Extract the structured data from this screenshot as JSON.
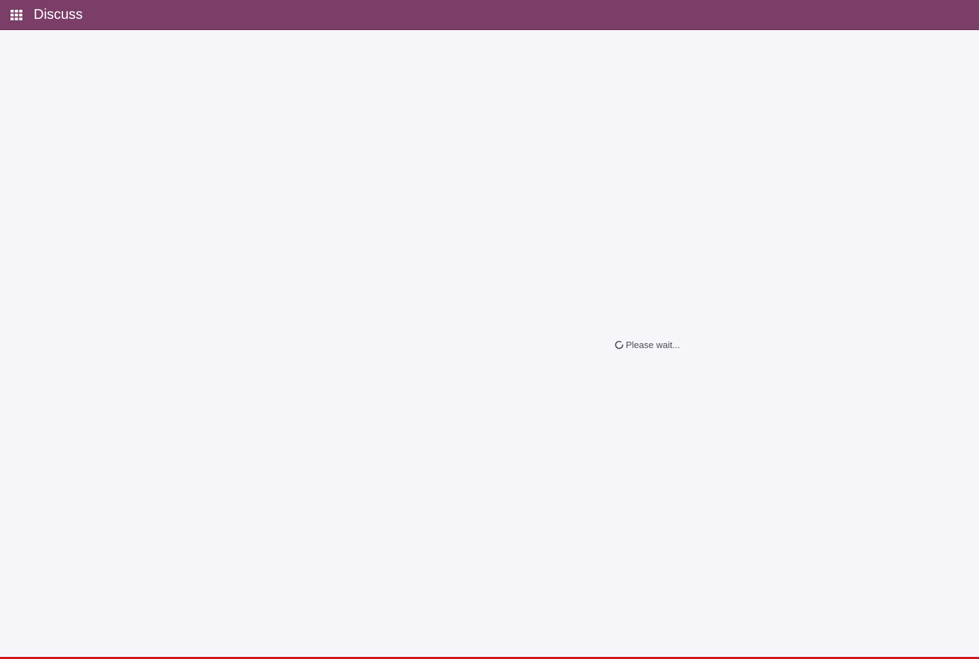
{
  "navbar": {
    "app_title": "Discuss",
    "apps_icon": "apps-grid-icon",
    "background_color": "#7a3e68"
  },
  "main": {
    "loading_text": "Please wait...",
    "loading_icon": "spinner-icon",
    "background_color": "#f6f6fa"
  },
  "status_bar": {
    "color": "#d1141b"
  }
}
